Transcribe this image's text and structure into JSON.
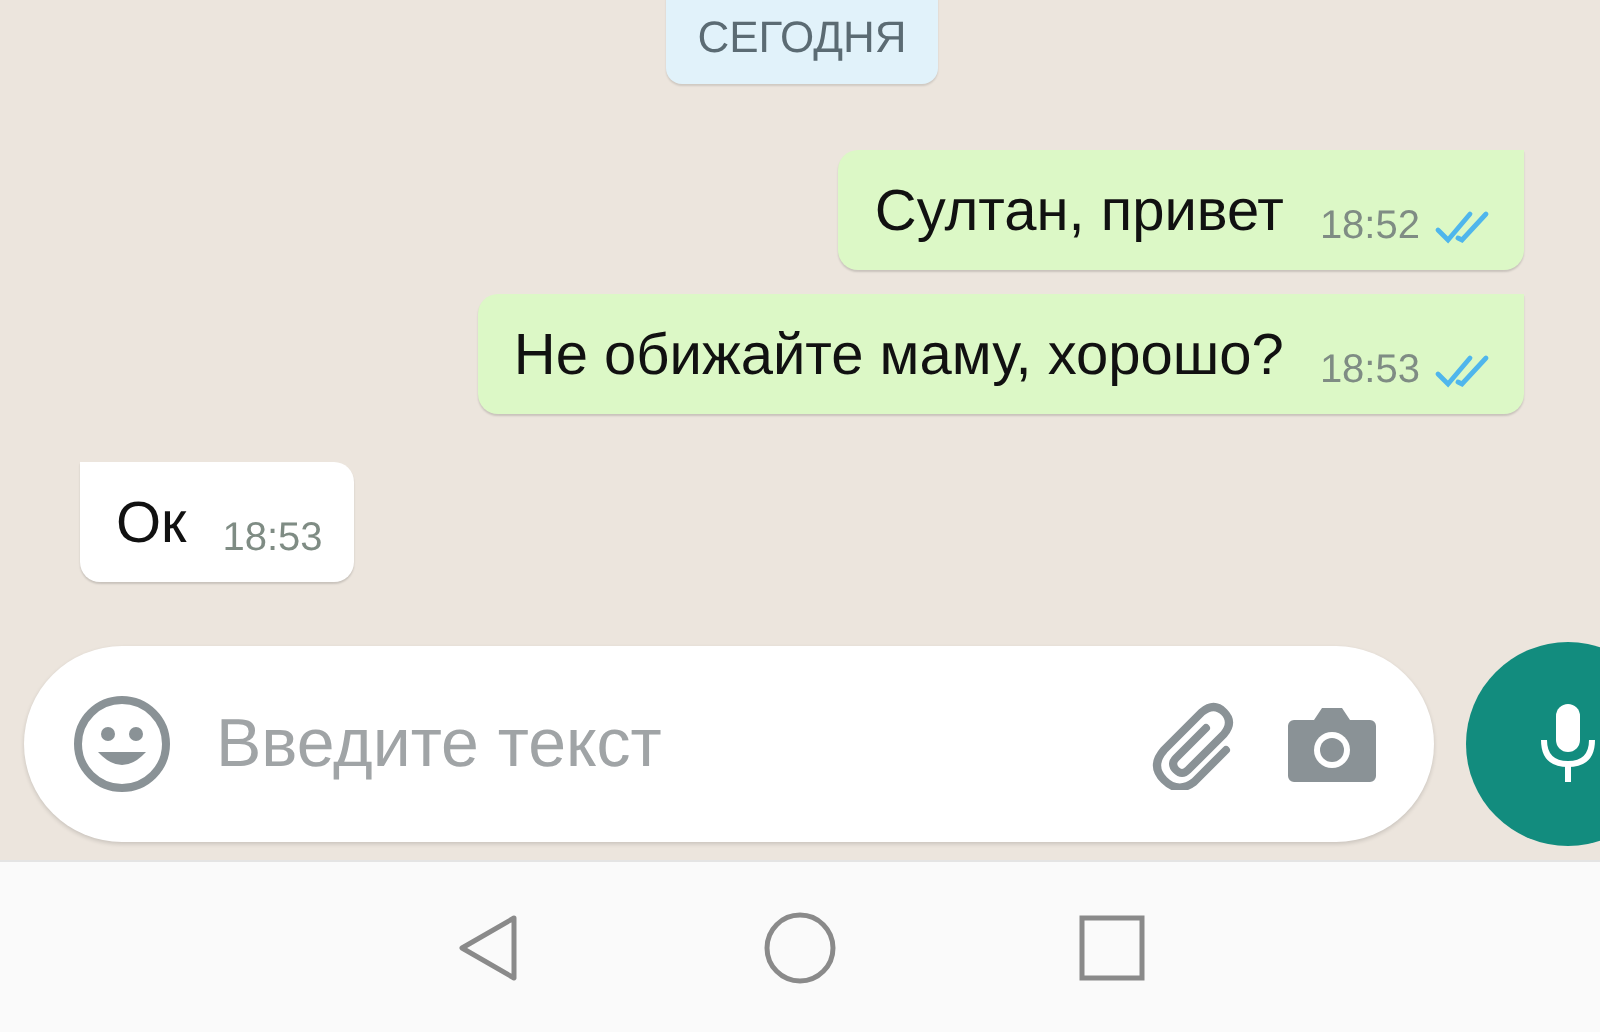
{
  "date_chip": "СЕГОДНЯ",
  "messages": [
    {
      "kind": "outgoing",
      "text": "Султан, привет",
      "time": "18:52",
      "read": true
    },
    {
      "kind": "outgoing",
      "text": "Не обижайте маму, хорошо?",
      "time": "18:53",
      "read": true
    },
    {
      "kind": "incoming",
      "text": "Ок",
      "time": "18:53"
    }
  ],
  "composer": {
    "placeholder": "Введите текст"
  }
}
